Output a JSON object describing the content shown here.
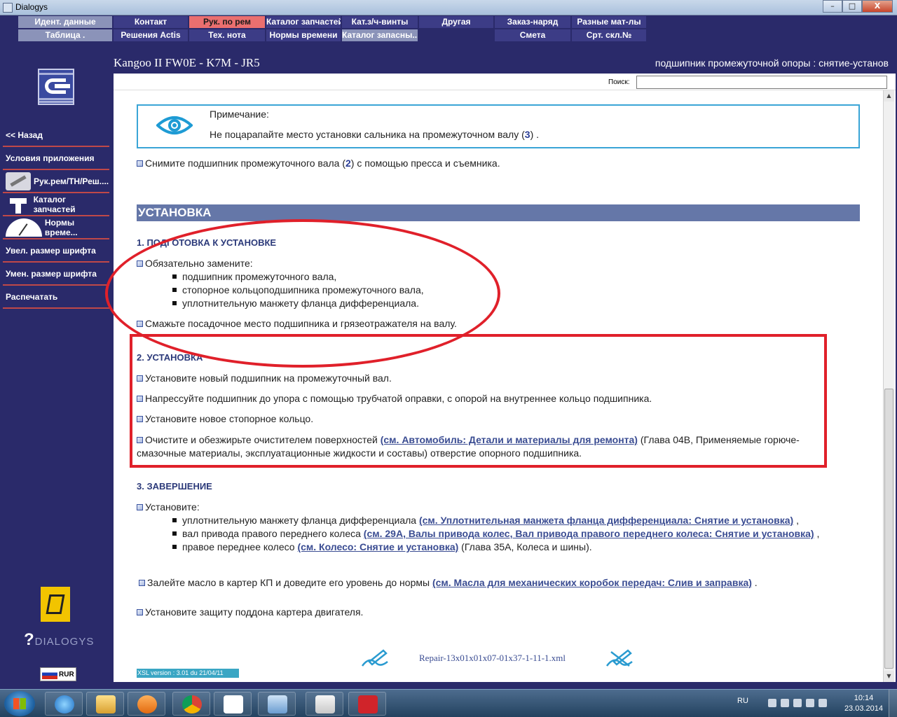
{
  "window": {
    "title": "Dialogys",
    "min": "–",
    "max": "□",
    "close": "X"
  },
  "menu": {
    "row1": [
      "Идент. данные",
      "Контакт",
      "Рук. по рем",
      "Каталог запчастей",
      "Кат.з/ч-винты",
      "Другая",
      "Заказ-наряд",
      "Разные мат-лы"
    ],
    "row2": [
      "Таблица .",
      "Решения Actis",
      "Тех. нота",
      "Нормы времени",
      "Каталог запасны...",
      "",
      "Смета",
      "Срт. скл.№"
    ]
  },
  "sidebar": {
    "items": [
      "<< Назад",
      "Условия приложения",
      "Рук.рем/ТН/Реш....",
      "Каталог запчастей",
      "Нормы време...",
      "Увел. размер шрифта",
      "Умен. размер шрифта",
      "Распечатать"
    ],
    "brand": "DIALOGYS",
    "brand_q": "?",
    "currency": "RUR"
  },
  "header": {
    "vehicle": "Kangoo II FW0E - K7M - JR5",
    "operation": "подшипник промежуточной опоры : снятие-установ"
  },
  "search": {
    "label": "Поиск:",
    "value": ""
  },
  "doc": {
    "note_title": "Примечание:",
    "note_text_pre": "Не поцарапайте место установки сальника на промежуточном валу (",
    "note_ref": "3",
    "note_text_post": ") .",
    "step_remove_pre": "Снимите подшипник промежуточного вала (",
    "step_remove_ref": "2",
    "step_remove_post": ") с помощью пресса и съемника.",
    "section": "УСТАНОВКА",
    "sub1": "1. ПОДГОТОВКА К УСТАНОВКЕ",
    "replace_intro": "Обязательно замените:",
    "replace_items": [
      "подшипник промежуточного вала,",
      "стопорное кольцоподшипника промежуточного вала,",
      "уплотнительную манжету фланца дифференциала."
    ],
    "lubricate": "Смажьте посадочное место подшипника и грязеотражателя на валу.",
    "sub2": "2. УСТАНОВКА",
    "inst1": "Установите новый подшипник на промежуточный вал.",
    "inst2": "Напрессуйте подшипник до упора с помощью трубчатой оправки, с опорой на внутреннее кольцо подшипника.",
    "inst3": "Установите новое стопорное кольцо.",
    "inst4_pre": "Очистите и обезжирьте очистителем поверхностей ",
    "inst4_link": "(см. Автомобиль: Детали и материалы для ремонта)",
    "inst4_post": " (Глава 04B, Применяемые горюче-смазочные материалы, эксплуатационные жидкости и составы) отверстие опорного подшипника.",
    "sub3": "3. ЗАВЕРШЕНИЕ",
    "fit_intro": "Установите:",
    "fit1_pre": "уплотнительную манжету фланца дифференциала ",
    "fit1_link": "(см. Уплотнительная манжета фланца дифференциала: Снятие и установка)",
    "fit1_post": " ,",
    "fit2_pre": "вал привода правого переднего колеса ",
    "fit2_link": "(см. 29A, Валы привода колес, Вал привода правого переднего колеса: Снятие и установка)",
    "fit2_post": " ,",
    "fit3_pre": "правое переднее колесо ",
    "fit3_link": "(см. Колесо: Снятие и установка)",
    "fit3_post": " (Глава 35A, Колеса и шины).",
    "oil_pre": "Залейте масло в картер КП и доведите его уровень до нормы ",
    "oil_link": "(см. Масла для механических коробок передач: Слив и заправка)",
    "oil_post": " .",
    "guard": "Установите защиту поддона картера двигателя.",
    "file": "Repair-13x01x01x07-01x37-1-11-1.xml",
    "xsl": "XSL version : 3.01 du 21/04/11"
  },
  "taskbar": {
    "lang": "RU",
    "time": "10:14",
    "date": "23.03.2014"
  },
  "colors": {
    "bg": "#2a2a6a",
    "active_tab": "#ea6f6f",
    "section": "#6577a8",
    "annot": "#e0202a",
    "note_border": "#3aa5d6"
  }
}
